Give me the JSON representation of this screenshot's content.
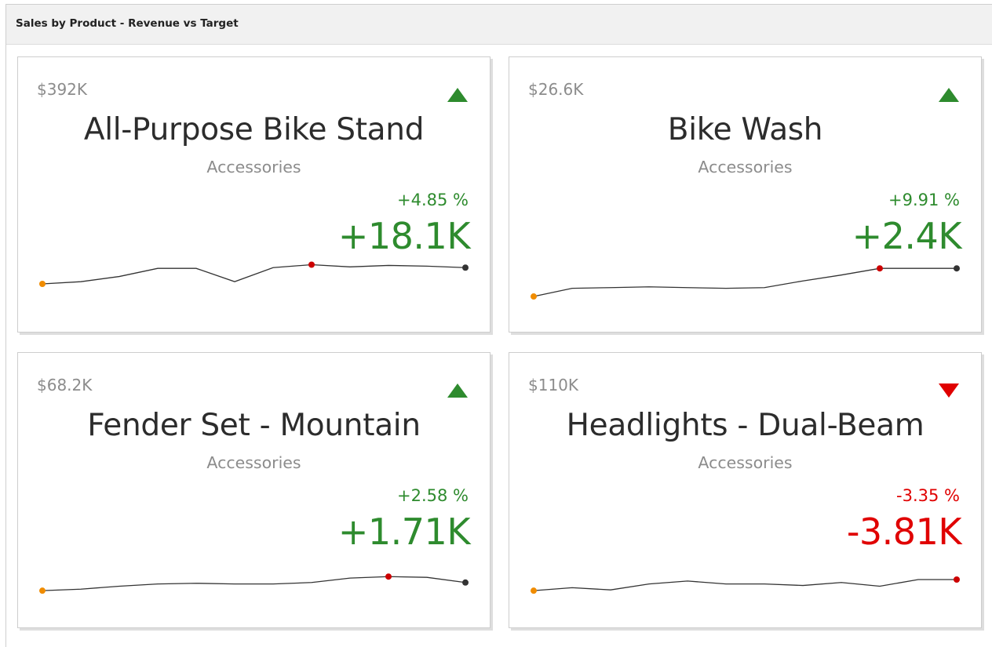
{
  "panel": {
    "title": "Sales by Product - Revenue vs Target"
  },
  "colors": {
    "positive": "#2e8b2e",
    "negative": "#e00000",
    "start_point": "#f08c00",
    "max_point": "#cc0000",
    "end_point": "#333333",
    "line": "#333333"
  },
  "cards": [
    {
      "value": "$392K",
      "title": "All-Purpose Bike Stand",
      "subtitle": "Accessories",
      "percent": "+4.85 %",
      "delta": "+18.1K",
      "trend": "up",
      "indicator_icon": "triangle-up-icon",
      "sparkline": [
        35,
        38,
        45,
        56,
        56,
        38,
        57,
        61,
        58,
        60,
        59,
        57
      ],
      "highlight_index": 7
    },
    {
      "value": "$26.6K",
      "title": "Bike Wash",
      "subtitle": "Accessories",
      "percent": "+9.91 %",
      "delta": "+2.4K",
      "trend": "up",
      "indicator_icon": "triangle-up-icon",
      "sparkline": [
        18,
        29,
        30,
        31,
        30,
        29,
        30,
        39,
        47,
        56,
        56,
        56
      ],
      "highlight_index": 9
    },
    {
      "value": "$68.2K",
      "title": "Fender Set - Mountain",
      "subtitle": "Accessories",
      "percent": "+2.58 %",
      "delta": "+1.71K",
      "trend": "up",
      "indicator_icon": "triangle-up-icon",
      "sparkline": [
        20,
        22,
        26,
        29,
        30,
        29,
        29,
        31,
        37,
        39,
        38,
        31
      ],
      "highlight_index": 9
    },
    {
      "value": "$110K",
      "title": "Headlights - Dual-Beam",
      "subtitle": "Accessories",
      "percent": "-3.35 %",
      "delta": "-3.81K",
      "trend": "down",
      "indicator_icon": "triangle-down-icon",
      "sparkline": [
        20,
        24,
        21,
        29,
        33,
        29,
        29,
        27,
        31,
        26,
        35,
        35
      ],
      "highlight_index": 11
    }
  ]
}
